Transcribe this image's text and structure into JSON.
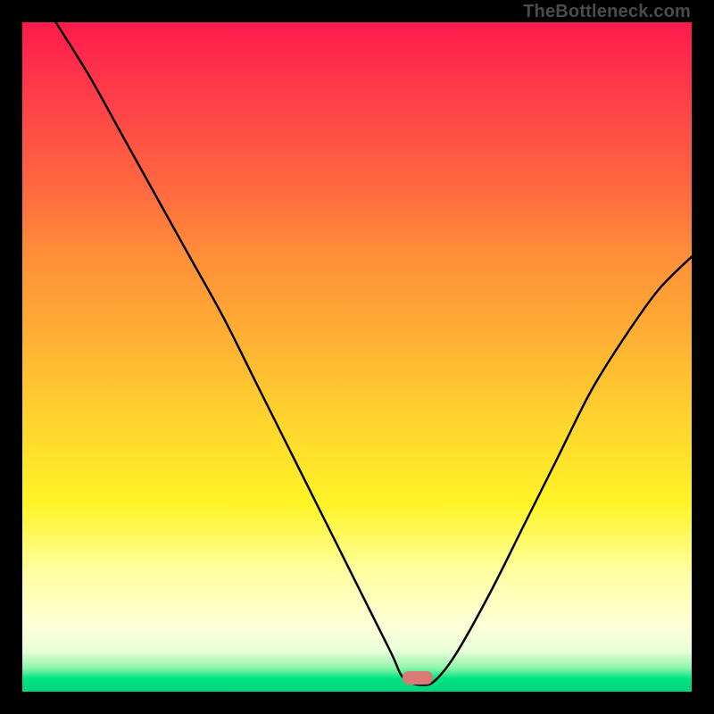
{
  "attribution": "TheBottleneck.com",
  "colors": {
    "gradient_top": "#ff1a4d",
    "gradient_mid": "#ffd52e",
    "gradient_bottom": "#00d37c",
    "curve": "#000000",
    "marker": "#d97a74",
    "frame": "#000000"
  },
  "chart_data": {
    "type": "line",
    "title": "",
    "xlabel": "",
    "ylabel": "",
    "xlim": [
      0,
      100
    ],
    "ylim": [
      0,
      100
    ],
    "grid": false,
    "legend": false,
    "series": [
      {
        "name": "curve",
        "x": [
          5,
          10,
          15,
          20,
          25,
          30,
          35,
          40,
          45,
          50,
          55,
          57,
          60,
          62,
          65,
          70,
          75,
          80,
          85,
          90,
          95,
          100
        ],
        "y": [
          100,
          92,
          83,
          74,
          65,
          56,
          46,
          36,
          26,
          16,
          6,
          2,
          1,
          2,
          6,
          15,
          25,
          35,
          45,
          53,
          60,
          65
        ]
      }
    ],
    "marker": {
      "x": 59,
      "y": 2,
      "shape": "rounded-rect"
    },
    "notes": "Values estimated from pixel positions; x and y in percent of plot area (0 at left/bottom, 100 at right/top)."
  }
}
